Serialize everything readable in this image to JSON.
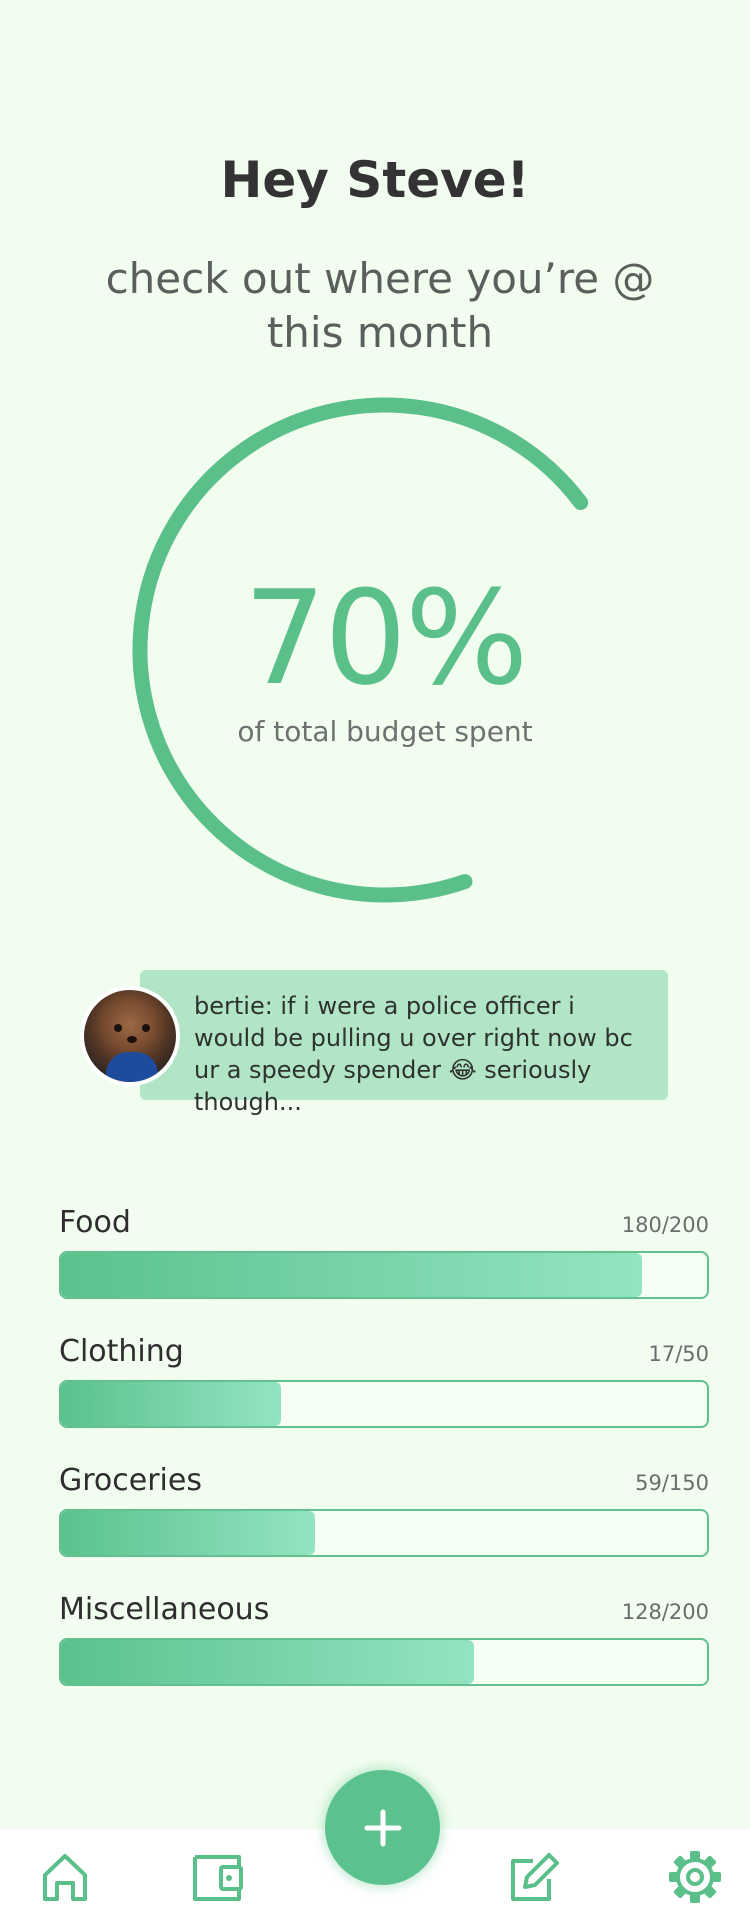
{
  "header": {
    "greeting": "Hey Steve!",
    "subtitle": "check out where you’re @ this month"
  },
  "budget": {
    "percent_label": "70%",
    "percent_value": 70,
    "caption": "of total budget spent",
    "accent_color": "#5bbf8a"
  },
  "message": {
    "avatar": "hamster-avatar",
    "text": "bertie: if i were a police officer i would be pulling u over right now bc ur a speedy spender 😂 seriously though..."
  },
  "categories": [
    {
      "name": "Food",
      "amount": "180/200",
      "spent": 180,
      "limit": 200
    },
    {
      "name": "Clothing",
      "amount": "17/50",
      "spent": 17,
      "limit": 50
    },
    {
      "name": "Groceries",
      "amount": "59/150",
      "spent": 59,
      "limit": 150
    },
    {
      "name": "Miscellaneous",
      "amount": "128/200",
      "spent": 128,
      "limit": 200
    }
  ],
  "nav": {
    "items": [
      {
        "icon": "home-icon"
      },
      {
        "icon": "wallet-icon"
      },
      {
        "icon": "edit-icon"
      },
      {
        "icon": "gear-icon"
      }
    ],
    "fab_icon": "plus-icon"
  }
}
